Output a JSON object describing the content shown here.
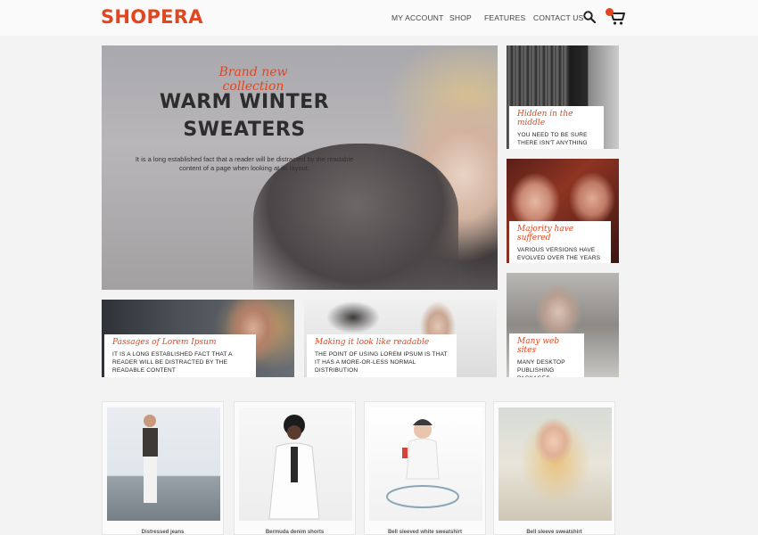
{
  "brand": {
    "logo": "SHOPERA",
    "accent": "#e2461f"
  },
  "nav": [
    {
      "label": "MY ACCOUNT"
    },
    {
      "label": "SHOP"
    },
    {
      "label": "FEATURES"
    },
    {
      "label": "CONTACT US"
    }
  ],
  "header_icons": {
    "search": "search-icon",
    "cart": "shopping-cart-icon"
  },
  "hero": {
    "kicker": "Brand new collection",
    "title_line1": "WARM WINTER",
    "title_line2": "SWEATERS",
    "text": "It is a long established fact that a reader will be distracted by the readable content of a page when looking at its layout."
  },
  "side_cards": [
    {
      "kicker": "Hidden in the middle",
      "text": "YOU NEED TO BE SURE THERE ISN'T ANYTHING"
    },
    {
      "kicker": "Majority have suffered",
      "text": "VARIOUS VERSIONS HAVE EVOLVED OVER THE YEARS"
    },
    {
      "kicker": "Many web sites",
      "text": "MANY DESKTOP PUBLISHING PACKAGES"
    }
  ],
  "bottom_cards": [
    {
      "kicker": "Passages of Lorem Ipsum",
      "text": "IT IS A LONG ESTABLISHED FACT THAT A READER WILL BE DISTRACTED BY THE READABLE CONTENT"
    },
    {
      "kicker": "Making it look like readable",
      "text": "THE POINT OF USING LOREM IPSUM IS THAT IT HAS A MORE-OR-LESS NORMAL DISTRIBUTION"
    }
  ],
  "products": [
    {
      "name": "Distressed jeans"
    },
    {
      "name": "Bermuda denim shorts"
    },
    {
      "name": "Bell sleeved white sweatshirt"
    },
    {
      "name": "Bell sleeve sweatshirt"
    }
  ]
}
